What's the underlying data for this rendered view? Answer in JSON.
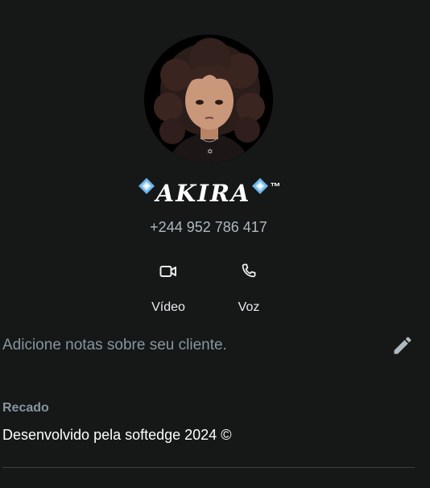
{
  "profile": {
    "name": "AKIRA",
    "trademark": "™",
    "phone": "+244 952 786 417",
    "avatar_alt": "avatar"
  },
  "actions": [
    {
      "label": "Vídeo",
      "icon": "video-camera-icon"
    },
    {
      "label": "Voz",
      "icon": "phone-icon"
    }
  ],
  "notes": {
    "placeholder": "Adicione notas sobre seu cliente.",
    "edit_icon": "pencil-icon"
  },
  "about": {
    "title": "Recado",
    "text": "Desenvolvido pela softedge 2024 ©"
  },
  "colors": {
    "background": "#161717",
    "secondary_text": "#8696a0",
    "diamond": "#6fb5e8"
  }
}
